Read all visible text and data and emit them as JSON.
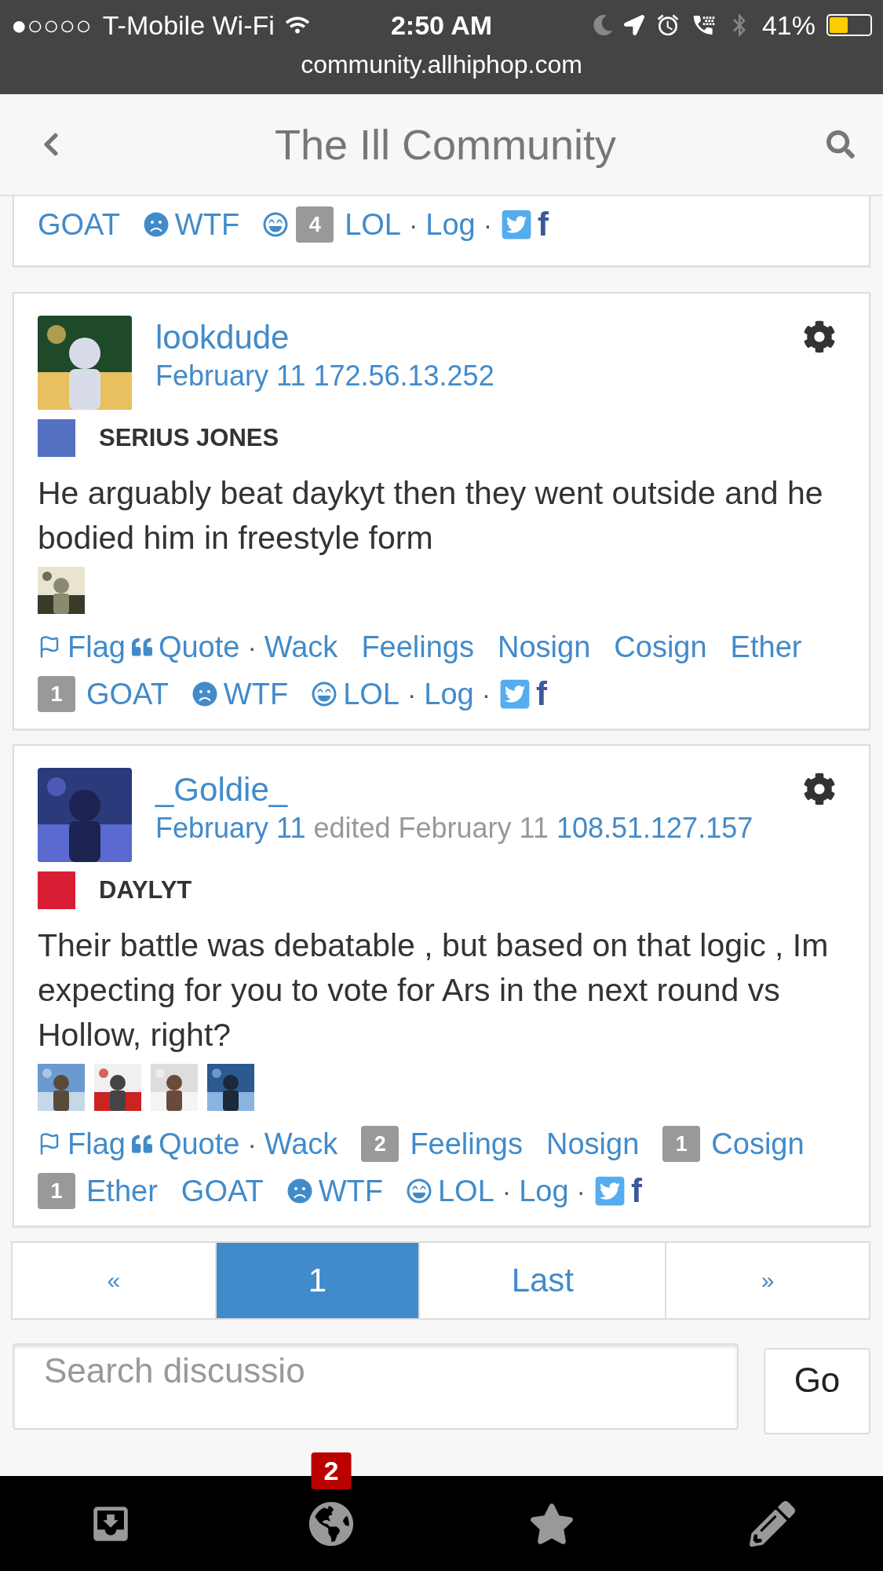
{
  "status_bar": {
    "signal": "●○○○○",
    "carrier": "T-Mobile Wi-Fi",
    "time": "2:50 AM",
    "battery": "41%",
    "url": "community.allhiphop.com"
  },
  "header": {
    "title": "The Ill Community"
  },
  "previous_post_actions": [
    [
      {
        "kind": "reaction",
        "label": "GOAT"
      },
      {
        "kind": "wtf",
        "label": "WTF"
      },
      {
        "kind": "lol",
        "label": "LOL",
        "count": "4"
      },
      {
        "kind": "dot",
        "label": "·"
      },
      {
        "kind": "link",
        "label": "Log"
      },
      {
        "kind": "dot",
        "label": "·"
      },
      {
        "kind": "twitter"
      },
      {
        "kind": "facebook",
        "label": "f"
      }
    ]
  ],
  "posts": [
    {
      "author": "lookdude",
      "date": "February 11",
      "ip": "172.56.13.252",
      "role": {
        "label": "SERIUS JONES",
        "color": "#5470c0"
      },
      "body": "He arguably beat daykyt then they went outside and he bodied him in freestyle form",
      "attachments": [
        {
          "kind": "picture"
        }
      ],
      "actions": [
        [
          {
            "kind": "flag",
            "label": "Flag"
          },
          {
            "kind": "quote",
            "label": "Quote"
          },
          {
            "kind": "dot",
            "label": "·"
          },
          {
            "kind": "reaction",
            "label": "Wack"
          },
          {
            "kind": "reaction",
            "label": "Feelings"
          },
          {
            "kind": "reaction",
            "label": "Nosign"
          },
          {
            "kind": "reaction",
            "label": "Cosign"
          },
          {
            "kind": "reaction",
            "label": "Ether"
          }
        ],
        [
          {
            "kind": "reaction",
            "label": "GOAT",
            "count": "1"
          },
          {
            "kind": "wtf",
            "label": "WTF"
          },
          {
            "kind": "lol",
            "label": "LOL"
          },
          {
            "kind": "dot",
            "label": "·"
          },
          {
            "kind": "link",
            "label": "Log"
          },
          {
            "kind": "dot",
            "label": "·"
          },
          {
            "kind": "twitter"
          },
          {
            "kind": "facebook",
            "label": "f"
          }
        ]
      ]
    },
    {
      "author": "_Goldie_",
      "date": "February 11",
      "edited": "edited February 11",
      "ip": "108.51.127.157",
      "role": {
        "label": "DAYLYT",
        "color": "#d81e34"
      },
      "body": "Their battle was debatable , but based on that logic , Im expecting for you to vote for Ars in the next round vs Hollow, right?",
      "attachments": [
        {
          "kind": "picture"
        },
        {
          "kind": "picture"
        },
        {
          "kind": "picture"
        },
        {
          "kind": "picture"
        }
      ],
      "actions": [
        [
          {
            "kind": "flag",
            "label": "Flag"
          },
          {
            "kind": "quote",
            "label": "Quote"
          },
          {
            "kind": "dot",
            "label": "·"
          },
          {
            "kind": "reaction",
            "label": "Wack"
          },
          {
            "kind": "reaction",
            "label": "Feelings",
            "count": "2"
          },
          {
            "kind": "reaction",
            "label": "Nosign"
          },
          {
            "kind": "reaction",
            "label": "Cosign",
            "count": "1"
          }
        ],
        [
          {
            "kind": "reaction",
            "label": "Ether",
            "count": "1"
          },
          {
            "kind": "reaction",
            "label": "GOAT"
          },
          {
            "kind": "wtf",
            "label": "WTF"
          },
          {
            "kind": "lol",
            "label": "LOL"
          },
          {
            "kind": "dot",
            "label": "·"
          },
          {
            "kind": "link",
            "label": "Log"
          },
          {
            "kind": "dot",
            "label": "·"
          },
          {
            "kind": "twitter"
          },
          {
            "kind": "facebook",
            "label": "f"
          }
        ]
      ]
    }
  ],
  "pagination": [
    {
      "label": "«",
      "selected": false
    },
    {
      "label": "1",
      "selected": true
    },
    {
      "label": "Last",
      "selected": false
    },
    {
      "label": "»",
      "selected": false
    }
  ],
  "search": {
    "placeholder": "Search discussio",
    "button": "Go"
  },
  "tab_bar": {
    "notification_badge": "2"
  }
}
